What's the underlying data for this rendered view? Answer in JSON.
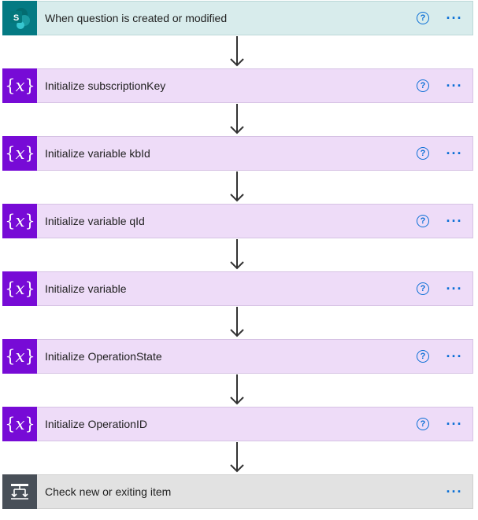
{
  "steps": [
    {
      "title": "When question is created or modified",
      "kind": "trigger",
      "icon": "sharepoint-icon",
      "has_help": true
    },
    {
      "title": "Initialize subscriptionKey",
      "kind": "variable",
      "icon": "variable-icon",
      "has_help": true
    },
    {
      "title": "Initialize variable kbId",
      "kind": "variable",
      "icon": "variable-icon",
      "has_help": true
    },
    {
      "title": "Initialize variable qId",
      "kind": "variable",
      "icon": "variable-icon",
      "has_help": true
    },
    {
      "title": "Initialize variable",
      "kind": "variable",
      "icon": "variable-icon",
      "has_help": true
    },
    {
      "title": "Initialize OperationState",
      "kind": "variable",
      "icon": "variable-icon",
      "has_help": true
    },
    {
      "title": "Initialize OperationID",
      "kind": "variable",
      "icon": "variable-icon",
      "has_help": true
    },
    {
      "title": "Check new or exiting item",
      "kind": "condition",
      "icon": "condition-icon",
      "has_help": false
    }
  ],
  "icons": {
    "help": "?",
    "more": "···",
    "variable_left": "{",
    "variable_x": "x",
    "variable_right": "}",
    "sharepoint_letter": "S"
  },
  "colors": {
    "trigger_bg": "#d8ecec",
    "variable_bg": "#eedcf8",
    "condition_bg": "#e2e2e2",
    "sharepoint": "#047a83",
    "variable_icon": "#770bd6",
    "condition_icon": "#484f58",
    "accent": "#0b6fd6"
  }
}
